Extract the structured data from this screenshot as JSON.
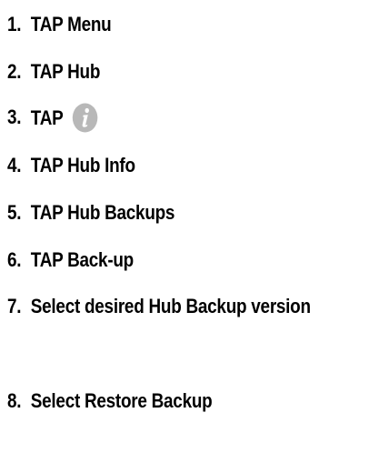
{
  "steps": [
    {
      "num": "1.",
      "text": "TAP Menu"
    },
    {
      "num": "2.",
      "text": "TAP Hub"
    },
    {
      "num": "3.",
      "text": "TAP",
      "icon": "info-icon"
    },
    {
      "num": "4.",
      "text": "TAP Hub Info"
    },
    {
      "num": "5.",
      "text": "TAP Hub Backups"
    },
    {
      "num": "6.",
      "text": "TAP Back-up"
    },
    {
      "num": "7.",
      "text": "Select desired Hub Backup version"
    },
    {
      "num": "8.",
      "text": "Select Restore Backup"
    }
  ],
  "colors": {
    "text": "#000000",
    "icon_fill": "#b8b8b8",
    "icon_glyph": "#ffffff"
  }
}
